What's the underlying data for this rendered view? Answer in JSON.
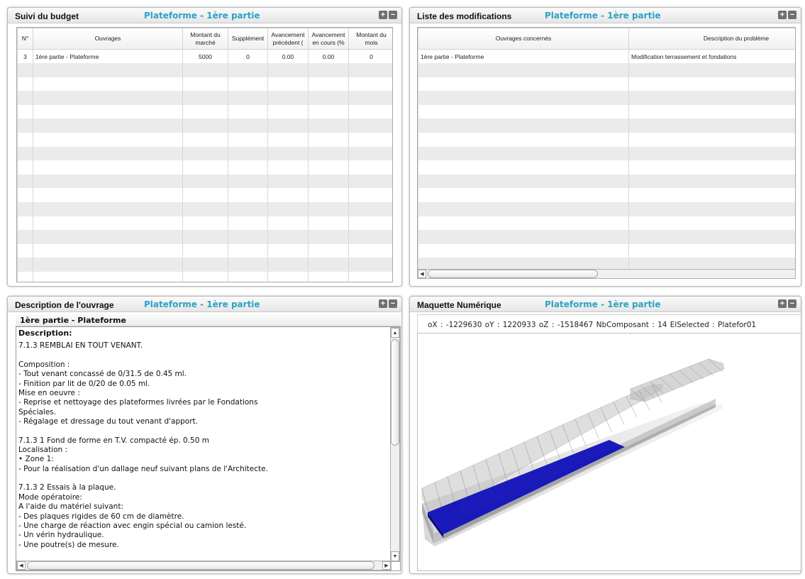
{
  "budget": {
    "title": "Suivi du budget",
    "subtitle": "Plateforme - 1ère partie",
    "columns": [
      "N°",
      "Ouvrages",
      "Montant du marché",
      "Supplément",
      "Avancement précédent (",
      "Avancement en cours (%",
      "Montant du mois"
    ],
    "rows": [
      [
        "3",
        "1ère partie - Plateforme",
        "5000",
        "0",
        "0.00",
        "0.00",
        "0"
      ]
    ]
  },
  "modifications": {
    "title": "Liste des modifications",
    "subtitle": "Plateforme - 1ère partie",
    "columns": [
      "Ouvrages concernés",
      "Description du problème"
    ],
    "rows": [
      [
        "1ère partie - Plateforme",
        "Modification terrassement et fondations"
      ]
    ]
  },
  "description": {
    "title": "Description de l'ouvrage",
    "subtitle": "Plateforme - 1ère partie",
    "ouvrage_name": "1ère partie - Plateforme",
    "heading": "Description:",
    "paragraphs": [
      "7.1.3 REMBLAI EN TOUT VENANT.",
      "",
      "Composition :",
      "- Tout venant concassé de 0/31.5 de 0.45 ml.",
      "- Finition par lit de 0/20 de 0.05 ml.",
      "Mise en oeuvre :",
      "- Reprise et nettoyage des plateformes livrées par le Fondations",
      "Spéciales.",
      "- Régalage et dressage du tout venant d'apport.",
      "",
      "7.1.3 1 Fond de forme en T.V. compacté ép. 0.50 m",
      "Localisation :",
      "• Zone 1:",
      "- Pour la réalisation d'un dallage neuf suivant plans de l'Architecte.",
      "",
      "7.1.3 2 Essais à la plaque.",
      "Mode opératoire:",
      "A l'aide du matériel suivant:",
      "- Des plaques rigides de 60 cm de diamètre.",
      "- Une charge de réaction avec engin spécial ou camion lesté.",
      "- Un vérin hydraulique.",
      "- Une poutre(s) de mesure."
    ]
  },
  "maquette": {
    "title": "Maquette Numérique",
    "subtitle": "Plateforme - 1ère partie",
    "coords": "oX : -1229630   oY : 1220933   oZ : -1518467   NbComposant : 14   ElSelected : Platefor01",
    "selection_color": "#1010b8"
  },
  "window_buttons": {
    "expand": "+",
    "collapse": "−"
  }
}
